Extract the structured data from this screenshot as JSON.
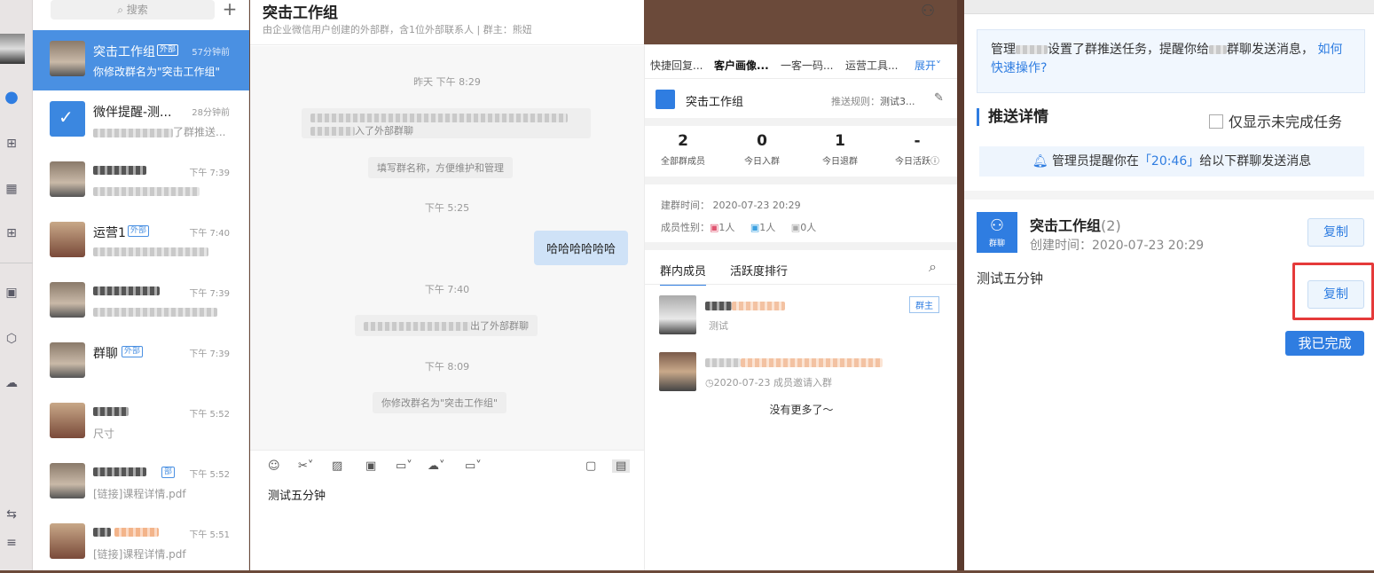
{
  "search": {
    "placeholder": "搜索"
  },
  "chats": [
    {
      "name": "突击工作组",
      "tag": "外部",
      "time": "57分钟前",
      "preview": "你修改群名为\"突击工作组\""
    },
    {
      "name": "微伴提醒-测...",
      "tag": "",
      "time": "28分钟前",
      "preview": "了群推送..."
    },
    {
      "name": "",
      "tag": "",
      "time": "下午 7:39",
      "preview": ""
    },
    {
      "name": "运营1",
      "tag": "外部",
      "time": "下午 7:40",
      "preview": ""
    },
    {
      "name": "",
      "tag": "",
      "time": "下午 7:39",
      "preview": ""
    },
    {
      "name": "群聊",
      "tag": "外部",
      "time": "下午 7:39",
      "preview": ""
    },
    {
      "name": "",
      "tag": "",
      "time": "下午 5:52",
      "preview": "尺寸"
    },
    {
      "name": "",
      "tag": "部",
      "time": "下午 5:52",
      "preview": "[链接]课程详情.pdf"
    },
    {
      "name": "",
      "tag": "",
      "time": "下午 5:51",
      "preview": "[链接]课程详情.pdf"
    }
  ],
  "chat": {
    "title": "突击工作组",
    "subtitle": "由企业微信用户创建的外部群，含1位外部联系人 | 群主：熊妞",
    "messages": {
      "t1": "昨天 下午 8:29",
      "sys1_tail": "入了外部群聊",
      "sys2": "填写群名称，方便维护和管理",
      "t2": "下午 5:25",
      "bubble": "哈哈哈哈哈哈",
      "t3": "下午 7:40",
      "sys3_tail": "出了外部群聊",
      "t4": "下午 8:09",
      "sys4": "你修改群名为\"突击工作组\""
    },
    "composer_text": "测试五分钟"
  },
  "side": {
    "tabs": [
      "快捷回复...",
      "客户画像...",
      "一客一码...",
      "运营工具...",
      "展开"
    ],
    "group_name": "突击工作组",
    "push_rule": "推送规则：",
    "push_rule_val": "测试3...",
    "stats": [
      {
        "value": "2",
        "label": "全部群成员"
      },
      {
        "value": "0",
        "label": "今日入群"
      },
      {
        "value": "1",
        "label": "今日退群"
      },
      {
        "value": "-",
        "label": "今日活跃"
      }
    ],
    "created": "建群时间：  2020-07-23 20:29",
    "gender_label": "成员性别：",
    "gender": [
      "1人",
      "1人",
      "0人"
    ],
    "member_tabs": [
      "群内成员",
      "活跃度排行"
    ],
    "owner_tag": "群主",
    "member1_sub": "测试",
    "member2_sub": "2020-07-23    成员邀请入群",
    "no_more": "没有更多了～"
  },
  "right": {
    "notice_pre": "管理",
    "notice_mid": "设置了群推送任务，提醒你给",
    "notice_end": "群聊发送消息，",
    "notice_link": "如何快速操作?",
    "title": "推送详情",
    "checkbox": "仅显示未完成任务",
    "remind_pre": "管理员提醒你在",
    "remind_time": "「20:46」",
    "remind_post": "给以下群聊发送消息",
    "group_name": "突击工作组",
    "group_count": "(2)",
    "group_created": "创建时间：2020-07-23 20:29",
    "avatar_label": "群聊",
    "copy": "复制",
    "message": "测试五分钟",
    "done": "我已完成"
  }
}
